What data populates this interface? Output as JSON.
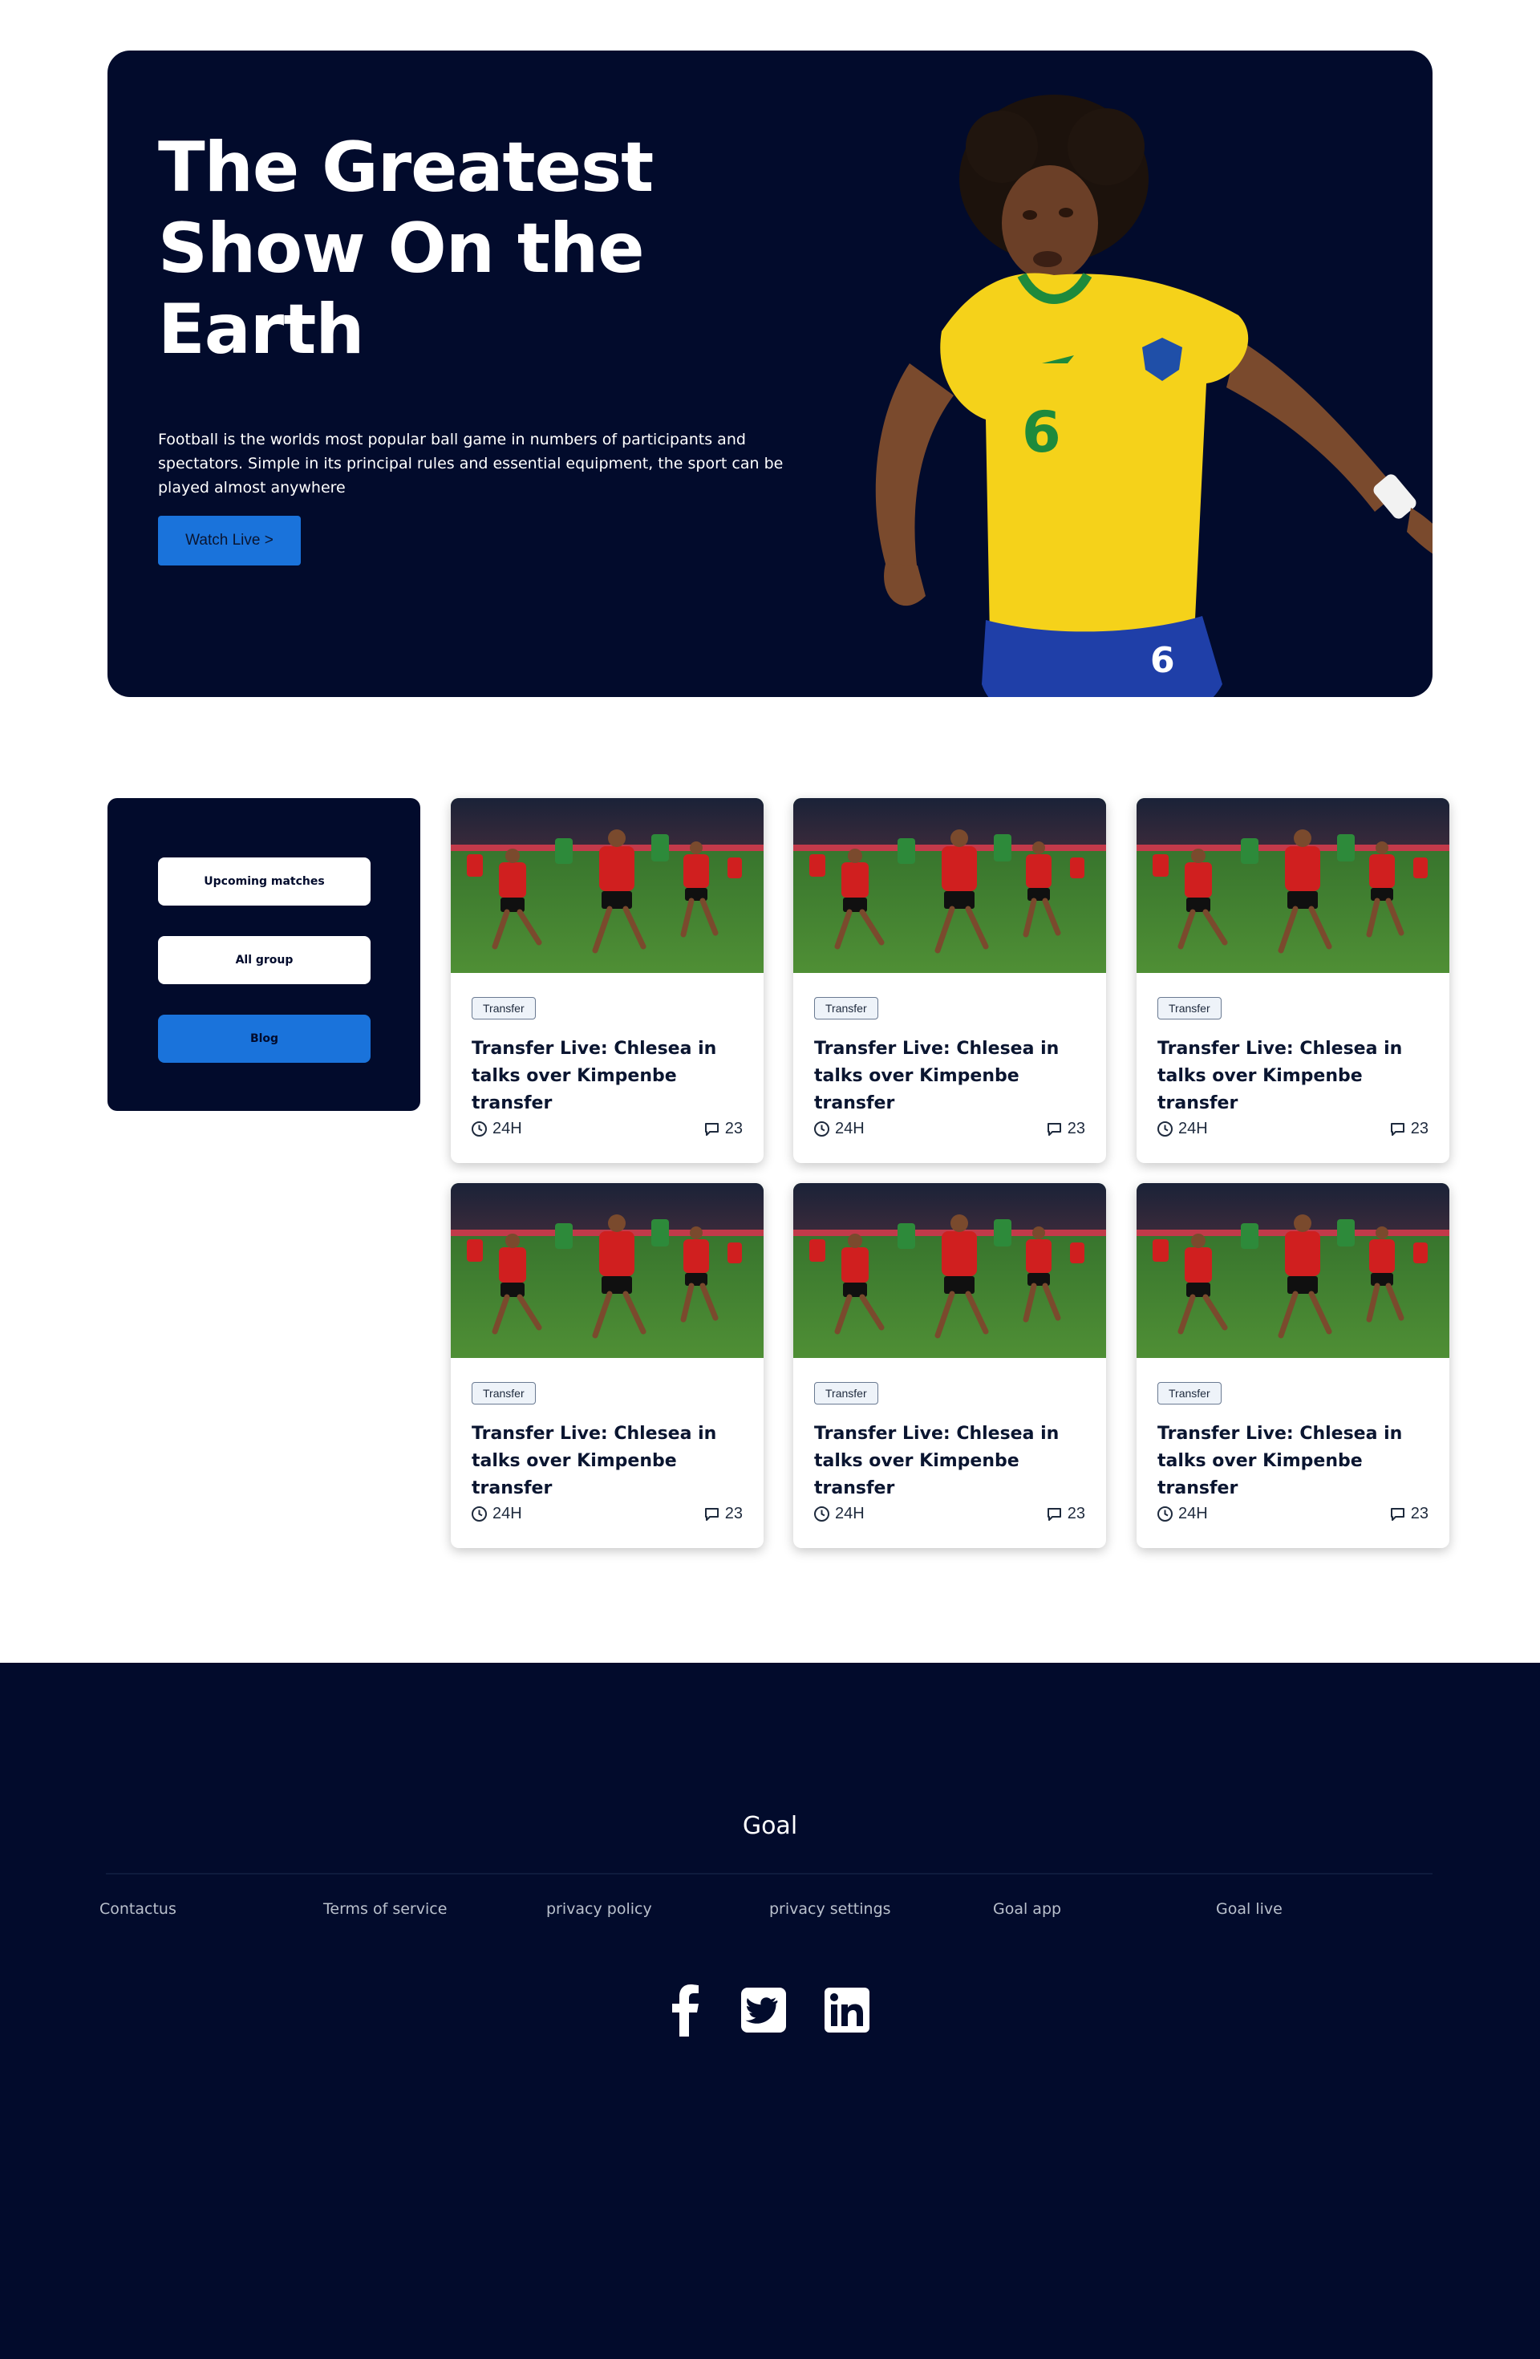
{
  "hero": {
    "title": "The Greatest Show On the Earth",
    "description": "Football is the worlds most popular ball game in numbers of participants and spectators. Simple in its principal rules and essential equipment, the sport can be played almost anywhere",
    "cta_label": "Watch Live >"
  },
  "side_menu": {
    "items": [
      {
        "label": "Upcoming matches",
        "active": false
      },
      {
        "label": "All group",
        "active": false
      },
      {
        "label": "Blog",
        "active": true
      }
    ]
  },
  "cards": [
    {
      "tag": "Transfer",
      "title": "Transfer Live: Chlesea in talks over Kimpenbe transfer",
      "time": "24H",
      "comments": "23"
    },
    {
      "tag": "Transfer",
      "title": "Transfer Live: Chlesea in talks over Kimpenbe transfer",
      "time": "24H",
      "comments": "23"
    },
    {
      "tag": "Transfer",
      "title": "Transfer Live: Chlesea in talks over Kimpenbe transfer",
      "time": "24H",
      "comments": "23"
    },
    {
      "tag": "Transfer",
      "title": "Transfer Live: Chlesea in talks over Kimpenbe transfer",
      "time": "24H",
      "comments": "23"
    },
    {
      "tag": "Transfer",
      "title": "Transfer Live: Chlesea in talks over Kimpenbe transfer",
      "time": "24H",
      "comments": "23"
    },
    {
      "tag": "Transfer",
      "title": "Transfer Live: Chlesea in talks over Kimpenbe transfer",
      "time": "24H",
      "comments": "23"
    }
  ],
  "footer": {
    "brand": "Goal",
    "links": [
      "Contactus",
      "Terms of service",
      "privacy policy",
      "privacy settings",
      "Goal app",
      "Goal live"
    ],
    "social_icons": [
      "facebook-icon",
      "twitter-icon",
      "linkedin-icon"
    ]
  },
  "colors": {
    "navy": "#020b2c",
    "accent_blue": "#1a73db",
    "white": "#ffffff"
  }
}
